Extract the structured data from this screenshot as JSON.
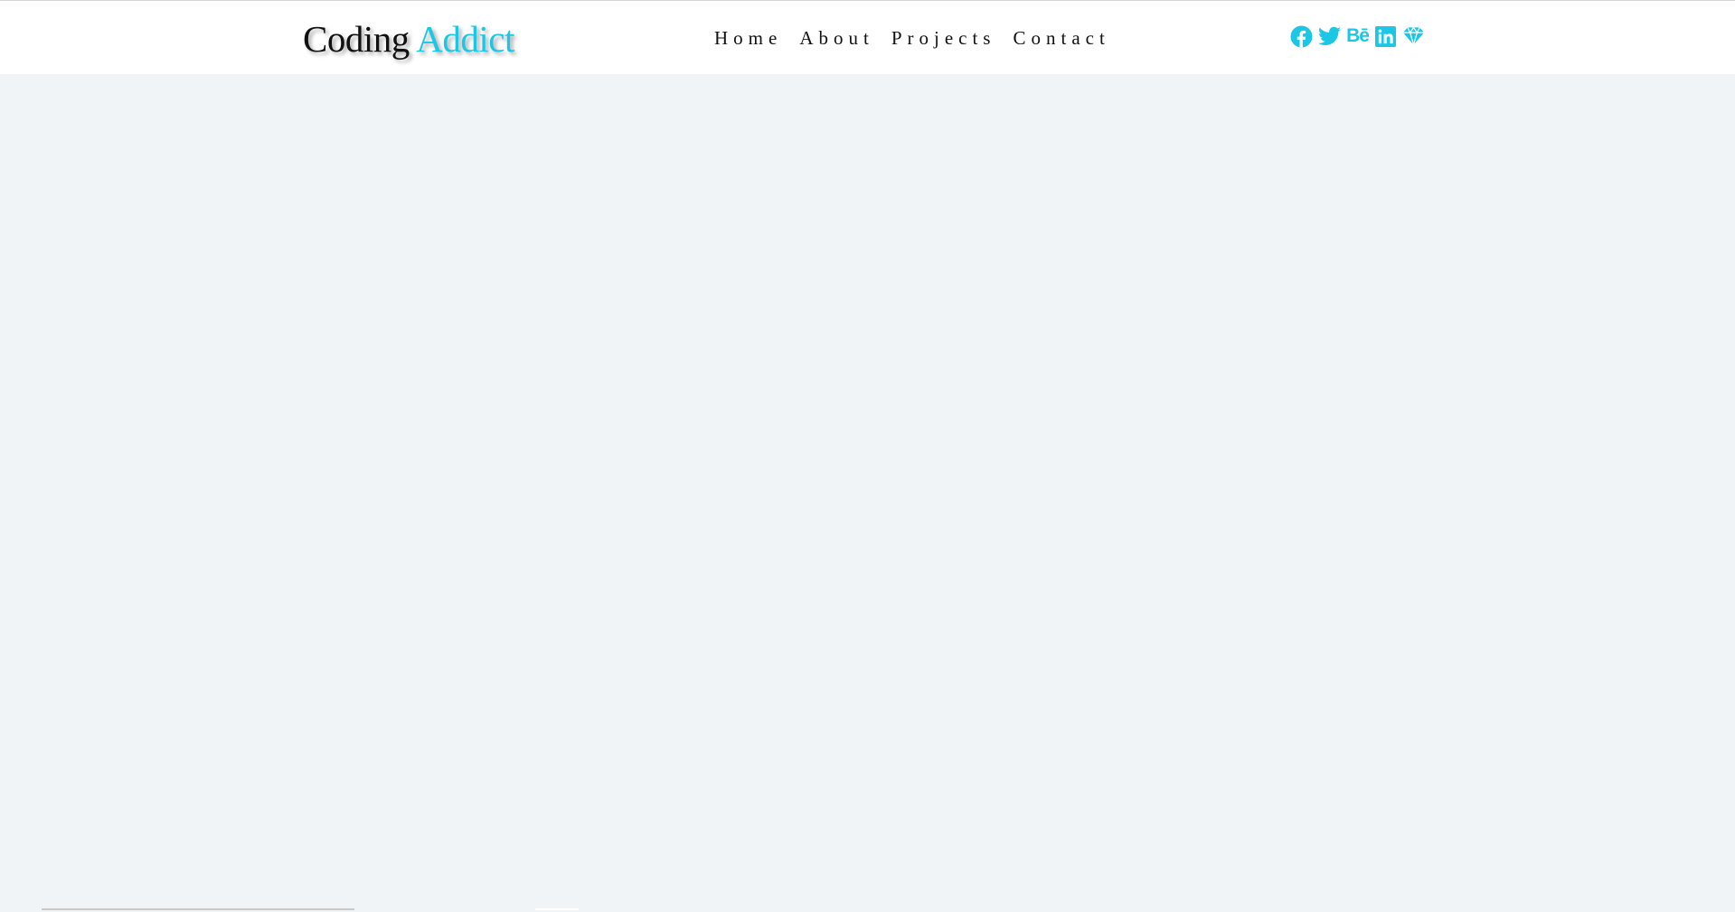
{
  "brand": {
    "first": "Coding",
    "second": "Addict",
    "accent_color": "#1cc7e6",
    "text_color": "#111111"
  },
  "nav": {
    "items": [
      {
        "label": "Home"
      },
      {
        "label": "About"
      },
      {
        "label": "Projects"
      },
      {
        "label": "Contact"
      }
    ]
  },
  "social": {
    "color": "#1cc7e6",
    "icons": [
      {
        "name": "facebook-icon"
      },
      {
        "name": "twitter-icon"
      },
      {
        "name": "behance-icon",
        "glyph": "Bē"
      },
      {
        "name": "linkedin-icon"
      },
      {
        "name": "diamond-icon"
      }
    ]
  },
  "colors": {
    "page_background": "#f0f4f6",
    "navbar_background": "#ffffff"
  }
}
